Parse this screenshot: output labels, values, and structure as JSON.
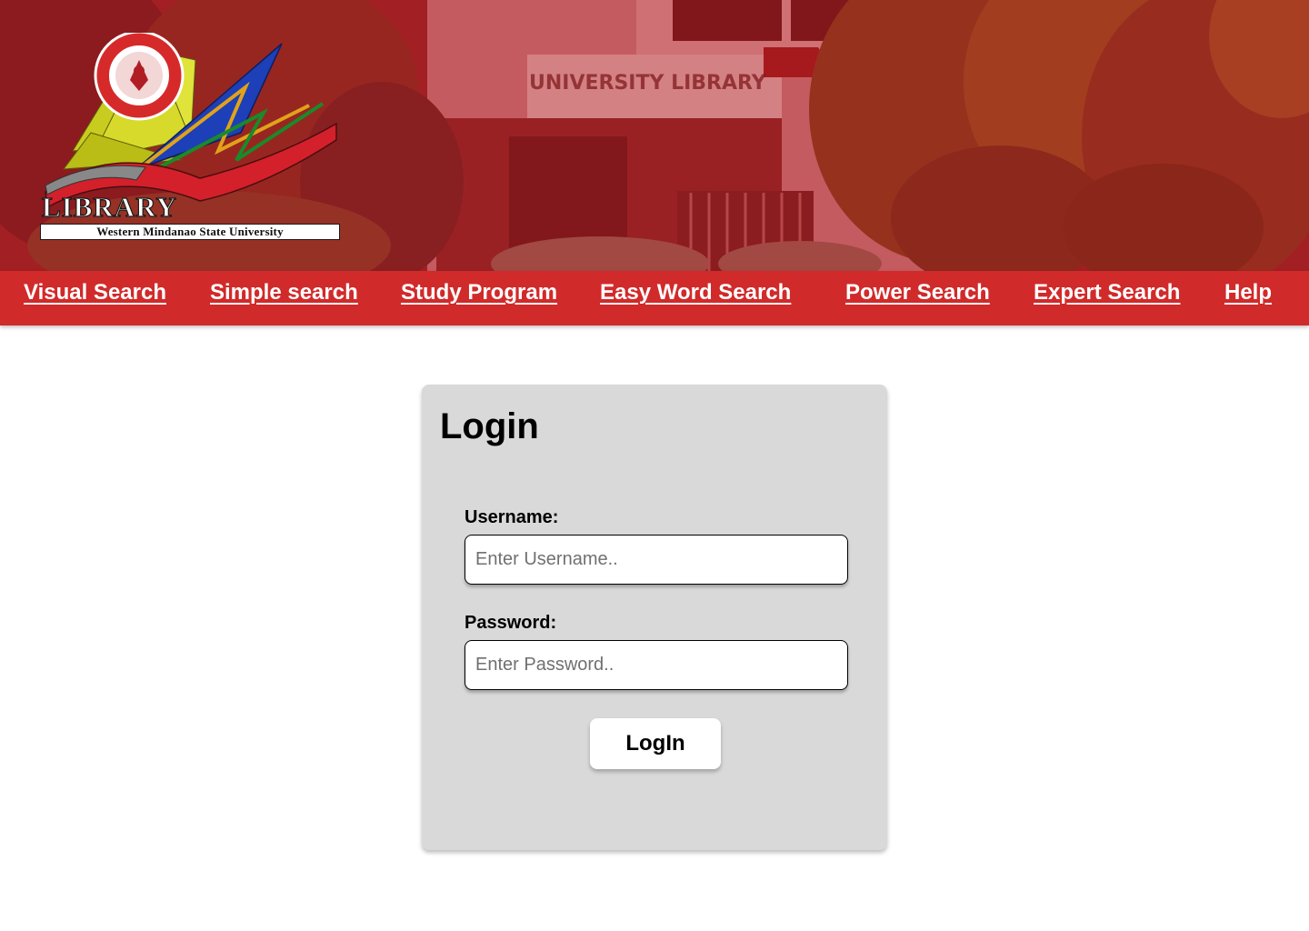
{
  "header": {
    "logo_word": "LIBRARY",
    "logo_subtitle": "Western Mindanao State University",
    "building_sign": "UNIVERSITY LIBRARY",
    "colors": {
      "overlay_red": "#b71c1c",
      "nav_red": "#d12a2a"
    }
  },
  "nav": {
    "items": [
      {
        "label": "Visual Search"
      },
      {
        "label": "Simple search"
      },
      {
        "label": "Study Program"
      },
      {
        "label": "Easy Word Search"
      },
      {
        "label": "Power Search"
      },
      {
        "label": "Expert Search"
      },
      {
        "label": "Help"
      }
    ]
  },
  "login": {
    "title": "Login",
    "username_label": "Username:",
    "username_placeholder": "Enter Username..",
    "username_value": "",
    "password_label": "Password:",
    "password_placeholder": "Enter Password..",
    "password_value": "",
    "button_label": "LogIn",
    "card_color": "#d9d9d9"
  }
}
